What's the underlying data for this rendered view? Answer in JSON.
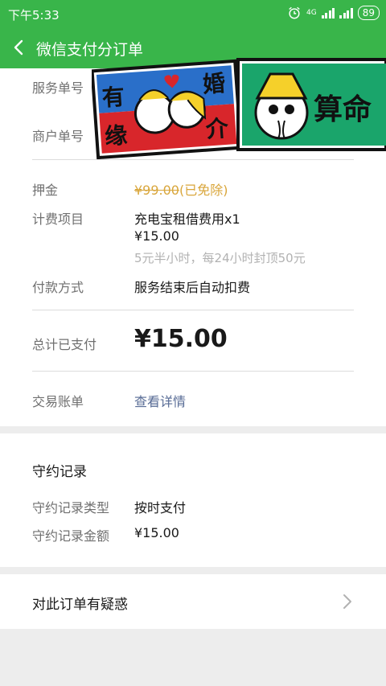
{
  "status_bar": {
    "time": "下午5:33",
    "network": "4G",
    "battery": "89",
    "icons": [
      "alarm-icon",
      "signal-icon",
      "signal-icon"
    ]
  },
  "nav": {
    "back_icon": "chevron-left-icon",
    "title": "微信支付分订单"
  },
  "order": {
    "service_no_label": "服务单号",
    "merchant_no_label": "商户单号",
    "deposit_label": "押金",
    "deposit_value": "¥99.00",
    "deposit_note": "(已免除)",
    "billing_label": "计费项目",
    "billing_item": "充电宝租借费用x1",
    "billing_amount": "¥15.00",
    "billing_rule": "5元半小时，每24小时封顶50元",
    "payment_method_label": "付款方式",
    "payment_method_value": "服务结束后自动扣费",
    "total_label": "总计已支付",
    "total_value": "¥15.00",
    "bill_label": "交易账单",
    "bill_link": "查看详情"
  },
  "promise": {
    "title": "守约记录",
    "type_label": "守约记录类型",
    "type_value": "按时支付",
    "amount_label": "守约记录金额",
    "amount_value": "¥15.00"
  },
  "question": {
    "label": "对此订单有疑惑",
    "icon": "chevron-right-icon"
  },
  "stickers": {
    "left_text": [
      "有",
      "缘",
      "婚",
      "介"
    ],
    "right_text": "算命"
  },
  "colors": {
    "brand_green": "#39b54a",
    "strike_orange": "#d9a63b",
    "link_blue": "#576b95",
    "sticker_blue": "#2a6fc9",
    "sticker_red": "#d8262b",
    "sticker_green": "#1aa56b"
  }
}
